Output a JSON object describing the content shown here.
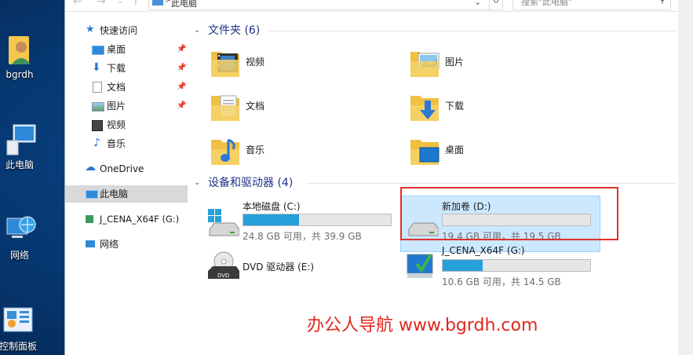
{
  "desktop": {
    "icons": [
      {
        "label": "bgrdh",
        "icon": "user-folder-icon"
      },
      {
        "label": "此电脑",
        "icon": "computer-icon"
      },
      {
        "label": "网络",
        "icon": "network-icon"
      },
      {
        "label": "控制面板",
        "icon": "control-panel-icon"
      }
    ]
  },
  "window": {
    "address": {
      "path": "此电脑",
      "separator": ">"
    },
    "search": {
      "placeholder": "搜索\"此电脑\""
    }
  },
  "nav": {
    "items": [
      {
        "label": "快速访问",
        "icon": "star-icon"
      },
      {
        "label": "桌面",
        "icon": "desktop-icon",
        "pinned": true
      },
      {
        "label": "下载",
        "icon": "download-icon",
        "pinned": true
      },
      {
        "label": "文档",
        "icon": "document-icon",
        "pinned": true
      },
      {
        "label": "图片",
        "icon": "picture-icon",
        "pinned": true
      },
      {
        "label": "视频",
        "icon": "video-icon"
      },
      {
        "label": "音乐",
        "icon": "music-icon"
      },
      {
        "label": "OneDrive",
        "icon": "cloud-icon"
      },
      {
        "label": "此电脑",
        "icon": "computer-icon",
        "selected": true
      },
      {
        "label": "J_CENA_X64F (G:)",
        "icon": "usb-drive-icon"
      },
      {
        "label": "网络",
        "icon": "network-icon"
      }
    ]
  },
  "folders_group": {
    "title": "文件夹 (6)",
    "items": [
      {
        "label": "视频",
        "icon": "video-folder-icon"
      },
      {
        "label": "图片",
        "icon": "picture-folder-icon"
      },
      {
        "label": "文档",
        "icon": "document-folder-icon"
      },
      {
        "label": "下载",
        "icon": "download-folder-icon"
      },
      {
        "label": "音乐",
        "icon": "music-folder-icon"
      },
      {
        "label": "桌面",
        "icon": "desktop-folder-icon"
      }
    ]
  },
  "drives_group": {
    "title": "设备和驱动器 (4)",
    "items": [
      {
        "label": "本地磁盘 (C:)",
        "info": "24.8 GB 可用，共 39.9 GB",
        "used_fraction": 0.38,
        "icon": "windows-drive-icon"
      },
      {
        "label": "新加卷 (D:)",
        "info": "19.4 GB 可用，共 19.5 GB",
        "used_fraction": 0.005,
        "icon": "hard-drive-icon",
        "selected": true
      },
      {
        "label": "DVD 驱动器 (E:)",
        "info": "",
        "used_fraction": null,
        "icon": "dvd-drive-icon"
      },
      {
        "label": "J_CENA_X64F (G:)",
        "info": "10.6 GB 可用，共 14.5 GB",
        "used_fraction": 0.27,
        "icon": "usb-install-drive-icon"
      }
    ]
  },
  "watermark": "办公人导航  www.bgrdh.com",
  "colors": {
    "accent": "#26a0da",
    "selection": "#cce8ff",
    "highlight": "#e0302a",
    "group_title": "#1e3287"
  }
}
